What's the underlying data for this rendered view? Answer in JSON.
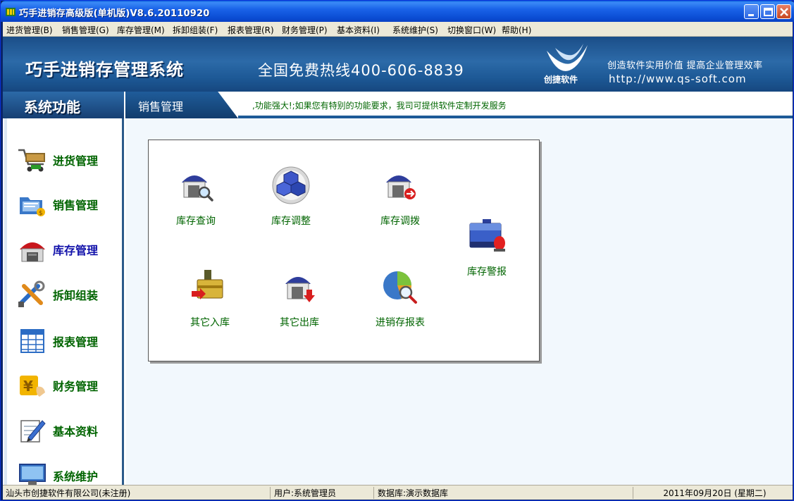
{
  "window": {
    "title": "巧手进销存高级版(单机版)V8.6.20110920"
  },
  "menu": [
    {
      "label": "进货管理(B)"
    },
    {
      "label": "销售管理(G)"
    },
    {
      "label": "库存管理(M)"
    },
    {
      "label": "拆卸组装(F)"
    },
    {
      "label": "报表管理(R)"
    },
    {
      "label": "财务管理(P)"
    },
    {
      "label": "基本资料(I)"
    },
    {
      "label": "系统维护(S)"
    },
    {
      "label": "切换窗口(W)"
    },
    {
      "label": "帮助(H)"
    }
  ],
  "banner": {
    "app_name": "巧手进销存管理系统",
    "hotline": "全国免费热线400-606-8839",
    "brand_name": "创捷软件",
    "slogan": "创造软件实用价值  提高企业管理效率",
    "url": "http://www.qs-soft.com"
  },
  "section": {
    "sidebar_title": "系统功能",
    "current_module": "销售管理",
    "marquee": ",功能强大!;如果您有特别的功能要求，我司可提供软件定制开发服务"
  },
  "sidebar": {
    "items": [
      {
        "label": "进货管理",
        "icon": "shopping-cart-icon",
        "active": false
      },
      {
        "label": "销售管理",
        "icon": "sales-folder-icon",
        "active": false
      },
      {
        "label": "库存管理",
        "icon": "warehouse-icon",
        "active": true
      },
      {
        "label": "拆卸组装",
        "icon": "tools-icon",
        "active": false
      },
      {
        "label": "报表管理",
        "icon": "table-icon",
        "active": false
      },
      {
        "label": "财务管理",
        "icon": "yuan-coin-icon",
        "active": false
      },
      {
        "label": "基本资料",
        "icon": "pencil-notepad-icon",
        "active": false
      },
      {
        "label": "系统维护",
        "icon": "monitor-icon",
        "active": false
      }
    ]
  },
  "functions": [
    {
      "label": "库存查询",
      "icon": "warehouse-search-icon"
    },
    {
      "label": "库存调整",
      "icon": "cubes-icon"
    },
    {
      "label": "库存调拨",
      "icon": "warehouse-transfer-icon"
    },
    {
      "label": "库存警报",
      "icon": "alarm-case-icon"
    },
    {
      "label": "其它入库",
      "icon": "briefcase-in-icon"
    },
    {
      "label": "其它出库",
      "icon": "warehouse-out-icon"
    },
    {
      "label": "进销存报表",
      "icon": "pie-chart-search-icon"
    }
  ],
  "status": {
    "company": "汕头市创捷软件有限公司(未注册)",
    "user": "用户:系统管理员",
    "database": "数据库:演示数据库",
    "date": "2011年09月20日 (星期二)"
  },
  "colors": {
    "titlebar": "#0b4dd4",
    "banner": "#2c6aa8",
    "nav_text": "#006400",
    "nav_active": "#1111aa",
    "menu_bg": "#ece9d8"
  }
}
